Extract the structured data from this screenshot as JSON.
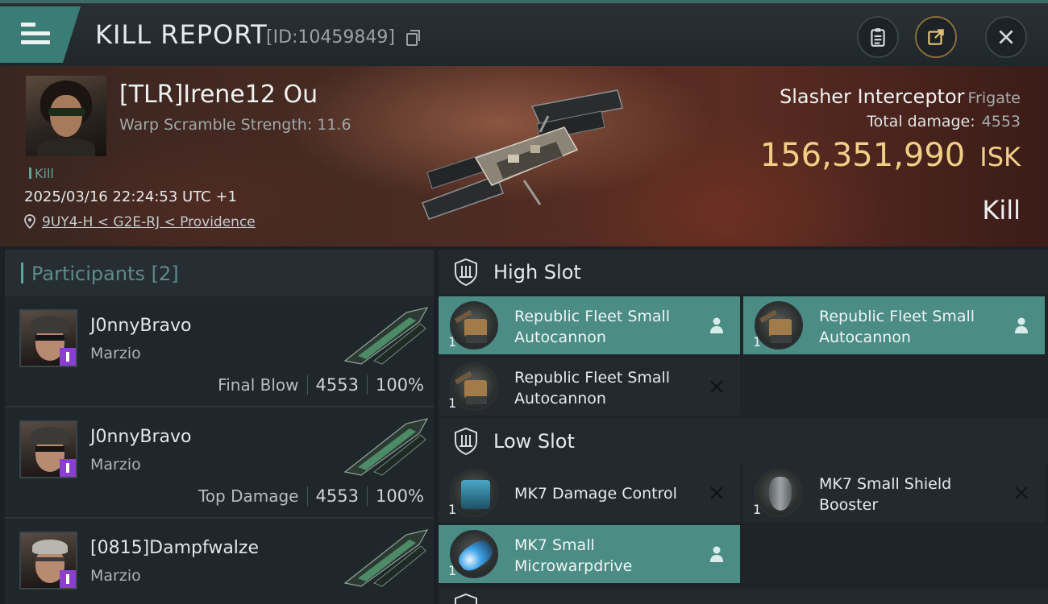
{
  "header": {
    "title": "KILL REPORT",
    "id_text": "[ID:10459849]"
  },
  "victim": {
    "name": "[TLR]Irene12 Ou",
    "subtitle": "Warp Scramble Strength: 11.6",
    "tag": "Kill",
    "time": "2025/03/16 22:24:53 UTC +1",
    "location": "9UY4-H < G2E-RJ < Providence",
    "ship_name": "Slasher Interceptor",
    "ship_class": "Frigate",
    "total_damage_label": "Total damage:",
    "total_damage": "4553",
    "isk_value": "156,351,990",
    "isk_unit": "ISK",
    "result": "Kill"
  },
  "participants": {
    "title": "Participants",
    "count": "[2]",
    "rows": [
      {
        "name": "J0nnyBravo",
        "corp": "Marzio",
        "label": "Final Blow",
        "damage": "4553",
        "percent": "100%"
      },
      {
        "name": "J0nnyBravo",
        "corp": "Marzio",
        "label": "Top Damage",
        "damage": "4553",
        "percent": "100%"
      },
      {
        "name": "[0815]Dampfwalze",
        "corp": "Marzio"
      }
    ]
  },
  "slots": {
    "high": {
      "label": "High Slot",
      "modules": [
        {
          "name_line1": "Republic Fleet Small",
          "name_line2": "Autocannon",
          "qty": "1",
          "state": "dropped"
        },
        {
          "name_line1": "Republic Fleet Small",
          "name_line2": "Autocannon",
          "qty": "1",
          "state": "dropped"
        },
        {
          "name_line1": "Republic Fleet Small",
          "name_line2": "Autocannon",
          "qty": "1",
          "state": "destroyed"
        }
      ]
    },
    "low": {
      "label": "Low Slot",
      "modules": [
        {
          "name_line1": "MK7 Damage Control",
          "name_line2": "",
          "qty": "1",
          "state": "destroyed"
        },
        {
          "name_line1": "MK7 Small Shield",
          "name_line2": "Booster",
          "qty": "1",
          "state": "destroyed"
        },
        {
          "name_line1": "MK7 Small",
          "name_line2": "Microwarpdrive",
          "qty": "1",
          "state": "dropped"
        }
      ]
    }
  },
  "colors": {
    "accent_teal": "#4b8c85",
    "isk_gold": "#f2cf87",
    "badge_purple": "#8b3fd1"
  },
  "icons": {
    "dropped": "person-icon",
    "destroyed": "x-icon"
  }
}
